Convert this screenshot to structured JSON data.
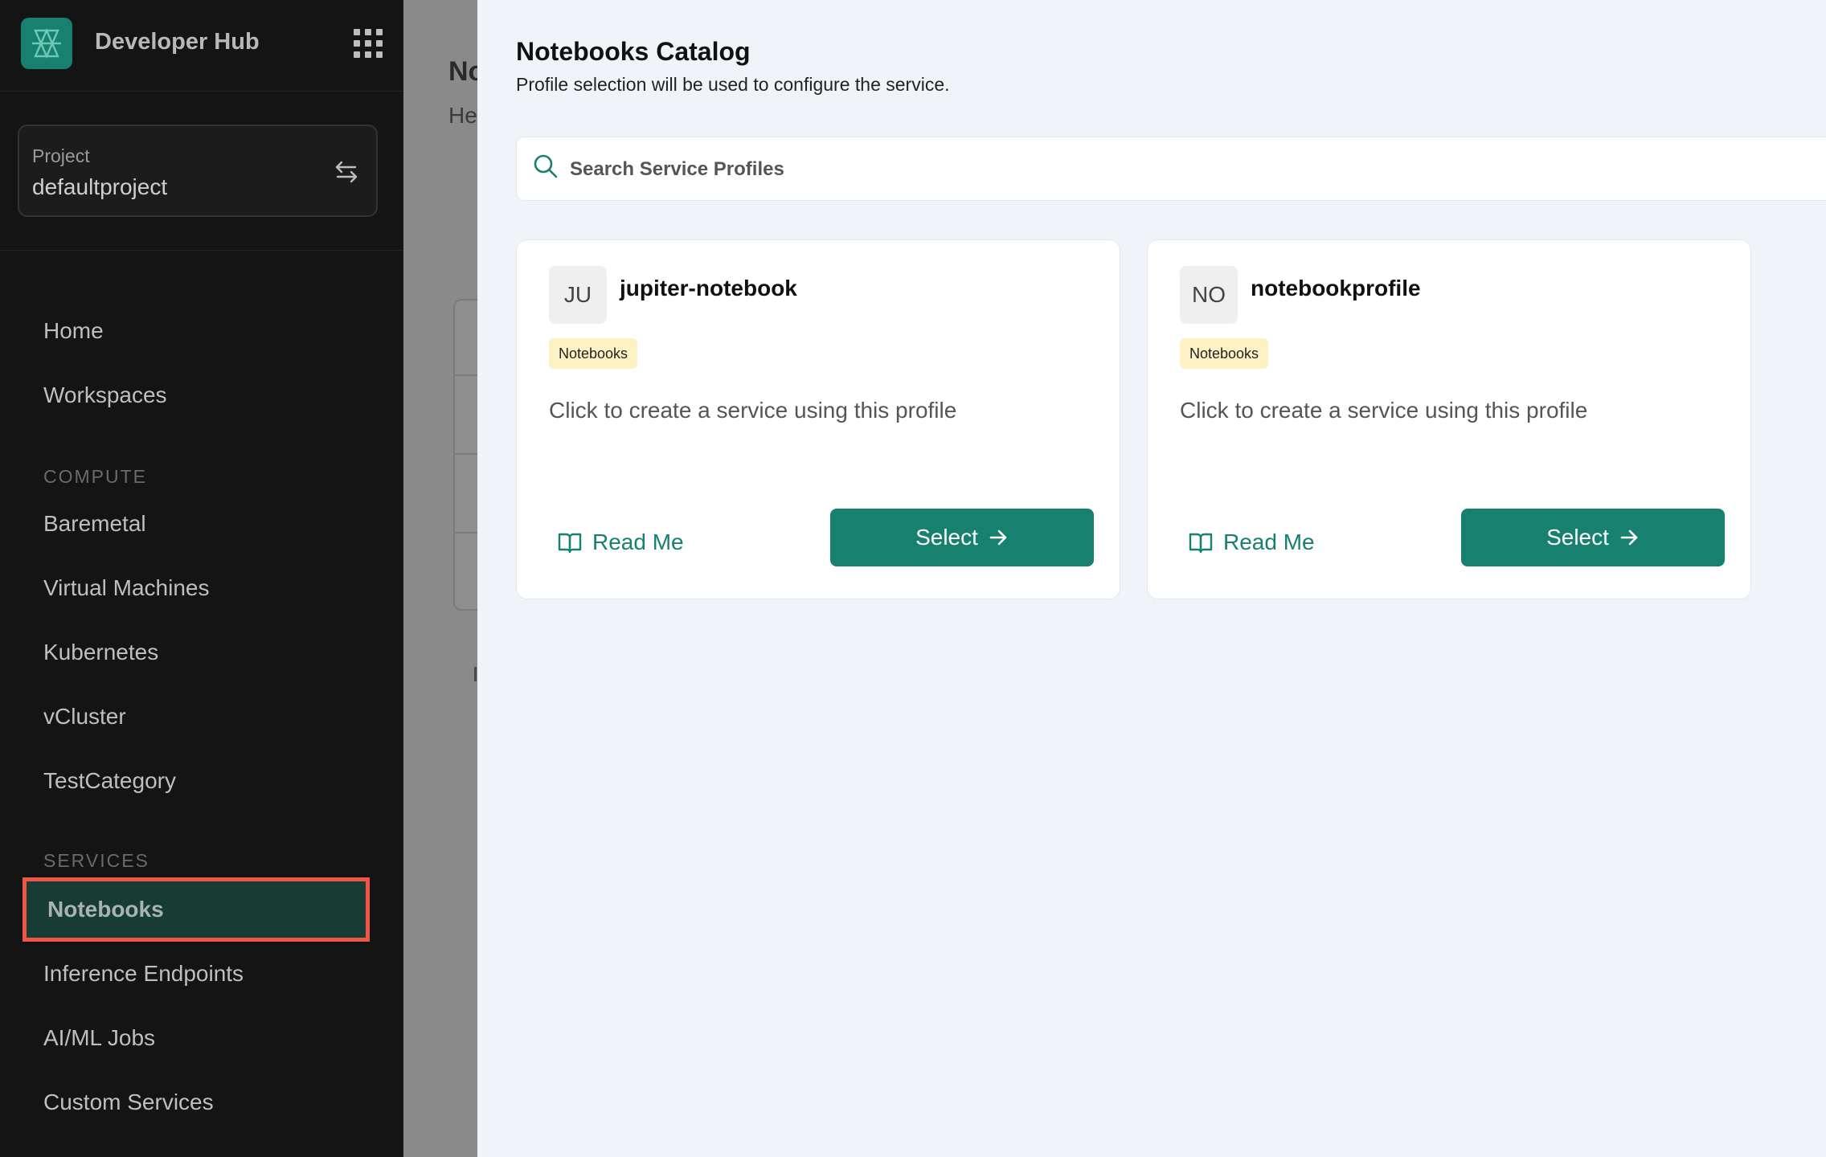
{
  "app": {
    "title": "Developer Hub"
  },
  "project": {
    "label": "Project",
    "value": "defaultproject"
  },
  "nav": {
    "top_items": [
      "Home",
      "Workspaces"
    ],
    "compute_label": "COMPUTE",
    "compute_items": [
      "Baremetal",
      "Virtual Machines",
      "Kubernetes",
      "vCluster",
      "TestCategory"
    ],
    "services_label": "SERVICES",
    "services_items": [
      "Notebooks",
      "Inference Endpoints",
      "AI/ML Jobs",
      "Custom Services"
    ],
    "active": "Notebooks"
  },
  "background_page": {
    "title": "No",
    "subtitle": "He"
  },
  "drawer": {
    "title": "Notebooks Catalog",
    "subtitle": "Profile selection will be used to configure the service.",
    "search": {
      "placeholder": "Search Service Profiles",
      "value": ""
    },
    "cards": [
      {
        "initials": "JU",
        "name": "jupiter-notebook",
        "badge": "Notebooks",
        "description": "Click to create a service using this profile",
        "readme_label": "Read Me",
        "select_label": "Select"
      },
      {
        "initials": "NO",
        "name": "notebookprofile",
        "badge": "Notebooks",
        "description": "Click to create a service using this profile",
        "readme_label": "Read Me",
        "select_label": "Select"
      }
    ]
  },
  "colors": {
    "accent": "#17806f",
    "sidebar_bg": "#141414",
    "highlight_border": "#f05545",
    "badge_bg": "#fdf2c4"
  },
  "icons": [
    "logo-icon",
    "apps-grid-icon",
    "swap-icon",
    "search-icon",
    "book-icon",
    "arrow-right-icon"
  ]
}
